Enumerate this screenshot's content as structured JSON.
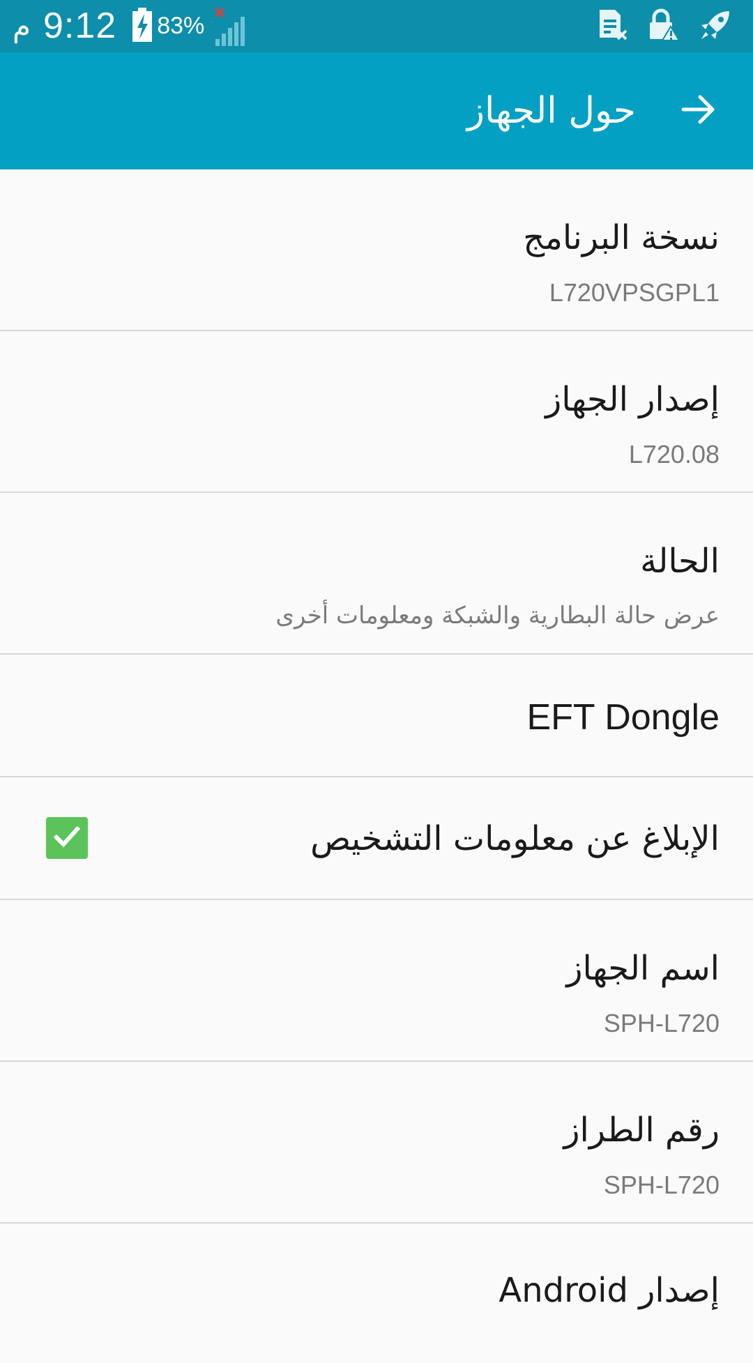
{
  "status_bar": {
    "time": "9:12",
    "ampm": "م",
    "battery_percent": "83%",
    "icons": [
      "battery-charging-icon",
      "signal-no-service-icon",
      "sim-error-icon",
      "lock-warning-icon",
      "rocket-icon"
    ]
  },
  "app_bar": {
    "title": "حول الجهاز",
    "back_icon": "arrow-back-icon"
  },
  "items": [
    {
      "title": "نسخة البرنامج",
      "subtitle": "L720VPSGPL1"
    },
    {
      "title": "إصدار الجهاز",
      "subtitle": "L720.08"
    },
    {
      "title": "الحالة",
      "subtitle": "عرض حالة البطارية والشبكة ومعلومات أخرى"
    },
    {
      "title": "EFT Dongle"
    },
    {
      "title": "الإبلاغ عن معلومات التشخيص",
      "checked": true
    },
    {
      "title": "اسم الجهاز",
      "subtitle": "SPH-L720"
    },
    {
      "title": "رقم الطراز",
      "subtitle": "SPH-L720"
    },
    {
      "title": "إصدار Android"
    }
  ],
  "colors": {
    "status_bar": "#0d8eaa",
    "app_bar": "#03a0c3",
    "checkbox": "#5cc35a",
    "background": "#fafafa"
  }
}
